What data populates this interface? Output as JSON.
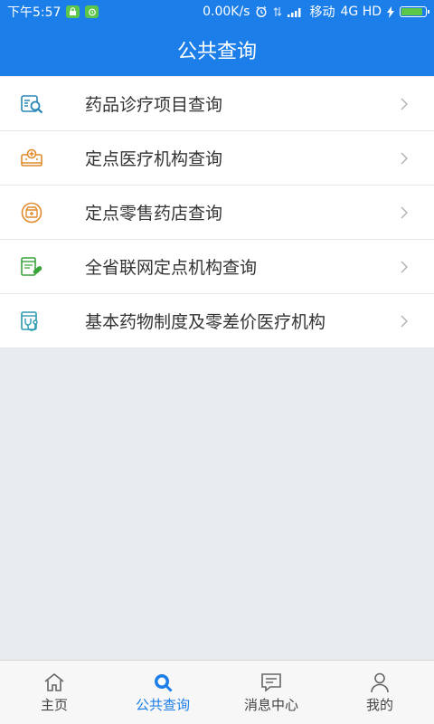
{
  "status_bar": {
    "time": "下午5:57",
    "speed": "0.00K/s",
    "carrier": "移动",
    "network": "4G HD",
    "battery_level": 0.9
  },
  "header": {
    "title": "公共查询"
  },
  "menu": {
    "items": [
      {
        "label": "药品诊疗项目查询",
        "icon": "drug-search-icon"
      },
      {
        "label": "定点医疗机构查询",
        "icon": "hospital-icon"
      },
      {
        "label": "定点零售药店查询",
        "icon": "pharmacy-icon"
      },
      {
        "label": "全省联网定点机构查询",
        "icon": "network-institution-icon"
      },
      {
        "label": "基本药物制度及零差价医疗机构",
        "icon": "stethoscope-icon"
      }
    ]
  },
  "tab_bar": {
    "tabs": [
      {
        "label": "主页",
        "icon": "home-icon",
        "active": false
      },
      {
        "label": "公共查询",
        "icon": "search-icon",
        "active": true
      },
      {
        "label": "消息中心",
        "icon": "message-icon",
        "active": false
      },
      {
        "label": "我的",
        "icon": "user-icon",
        "active": false
      }
    ]
  },
  "colors": {
    "primary": "#1c7ee8",
    "icon_blue": "#2a87b8",
    "icon_orange": "#e08a2c",
    "icon_green": "#3aa43a"
  }
}
